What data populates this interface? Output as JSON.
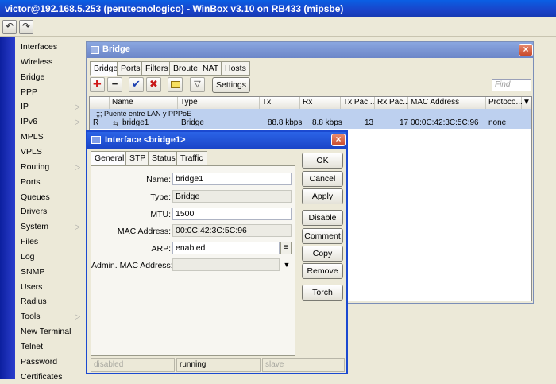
{
  "window": {
    "title": "victor@192.168.5.253 (perutecnologico) - WinBox v3.10 on RB433 (mipsbe)"
  },
  "toolbar": {
    "undo_icon": "undo-icon",
    "redo_icon": "redo-icon"
  },
  "sidebar": {
    "items": [
      {
        "label": "Interfaces",
        "submenu": false
      },
      {
        "label": "Wireless",
        "submenu": false
      },
      {
        "label": "Bridge",
        "submenu": false
      },
      {
        "label": "PPP",
        "submenu": false
      },
      {
        "label": "IP",
        "submenu": true
      },
      {
        "label": "IPv6",
        "submenu": true
      },
      {
        "label": "MPLS",
        "submenu": false
      },
      {
        "label": "VPLS",
        "submenu": false
      },
      {
        "label": "Routing",
        "submenu": true
      },
      {
        "label": "Ports",
        "submenu": false
      },
      {
        "label": "Queues",
        "submenu": false
      },
      {
        "label": "Drivers",
        "submenu": false
      },
      {
        "label": "System",
        "submenu": true
      },
      {
        "label": "Files",
        "submenu": false
      },
      {
        "label": "Log",
        "submenu": false
      },
      {
        "label": "SNMP",
        "submenu": false
      },
      {
        "label": "Users",
        "submenu": false
      },
      {
        "label": "Radius",
        "submenu": false
      },
      {
        "label": "Tools",
        "submenu": true
      },
      {
        "label": "New Terminal",
        "submenu": false
      },
      {
        "label": "Telnet",
        "submenu": false
      },
      {
        "label": "Password",
        "submenu": false
      },
      {
        "label": "Certificates",
        "submenu": false
      }
    ]
  },
  "bridge": {
    "title": "Bridge",
    "tabs": [
      "Bridge",
      "Ports",
      "Filters",
      "Broute",
      "NAT",
      "Hosts"
    ],
    "settings_label": "Settings",
    "find_placeholder": "Find",
    "columns": [
      "Name",
      "Type",
      "Tx",
      "Rx",
      "Tx Pac...",
      "Rx Pac...",
      "MAC Address",
      "Protoco..."
    ],
    "comment_row": ";;; Puente entre LAN y PPPoE",
    "rows": [
      {
        "flag": "R",
        "name": "bridge1",
        "type": "Bridge",
        "tx": "88.8 kbps",
        "rx": "8.8 kbps",
        "tx_packets": "13",
        "rx_packets": "17",
        "mac": "00:0C:42:3C:5C:96",
        "protocol": "none"
      }
    ]
  },
  "interface_dialog": {
    "title": "Interface <bridge1>",
    "tabs": [
      "General",
      "STP",
      "Status",
      "Traffic"
    ],
    "fields": {
      "name_label": "Name:",
      "name_value": "bridge1",
      "type_label": "Type:",
      "type_value": "Bridge",
      "mtu_label": "MTU:",
      "mtu_value": "1500",
      "mac_label": "MAC Address:",
      "mac_value": "00:0C:42:3C:5C:96",
      "arp_label": "ARP:",
      "arp_value": "enabled",
      "admin_mac_label": "Admin. MAC Address:",
      "admin_mac_value": ""
    },
    "buttons": [
      "OK",
      "Cancel",
      "Apply",
      "Disable",
      "Comment",
      "Copy",
      "Remove",
      "Torch"
    ],
    "status": [
      "disabled",
      "running",
      "slave"
    ]
  }
}
